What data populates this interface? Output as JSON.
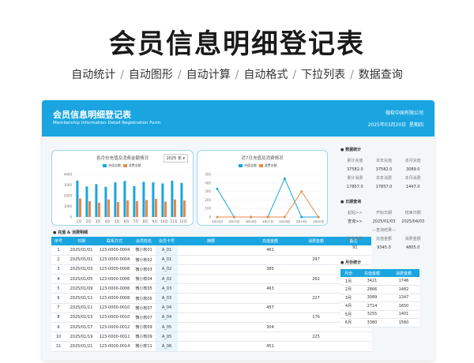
{
  "hero": {
    "title": "会员信息明细登记表",
    "features": [
      "自动统计",
      "自动图形",
      "自动计算",
      "自动格式",
      "下拉列表",
      "数据查询"
    ]
  },
  "banner": {
    "title": "会员信息明细登记表",
    "subtitle": "Membership Information Detail Registration Form",
    "company": "微软中国有限公司",
    "date": "2025年03月20日",
    "weekday": "星期四"
  },
  "colors": {
    "accent": "#1aa5e0",
    "orange": "#e88a4a"
  },
  "bar_chart": {
    "title": "各月份充值及消费金额情况",
    "year": "2025 年",
    "year_icon": "dropdown-icon",
    "legend": [
      "充值金额",
      "消费金额"
    ],
    "yticks": [
      "4000",
      "3000",
      "2000",
      "1000",
      "0"
    ]
  },
  "line_chart": {
    "title": "近7日充值及消费情况",
    "legend": [
      "充值金额",
      "消费金额"
    ],
    "yticks": [
      "500",
      "400",
      "300",
      "200",
      "100",
      "0"
    ]
  },
  "chart_data": [
    {
      "type": "bar",
      "title": "各月份充值及消费金额情况",
      "categories": [
        "1月",
        "2月",
        "3月",
        "4月",
        "5月",
        "6月",
        "7月",
        "8月",
        "9月",
        "10月",
        "11月",
        "12月"
      ],
      "series": [
        {
          "name": "充值金额",
          "values": [
            3421,
            2866,
            3089,
            2830,
            3255,
            3380,
            2900,
            3300,
            3250,
            3150,
            3400,
            3200
          ]
        },
        {
          "name": "消费金额",
          "values": [
            1746,
            1482,
            1347,
            1650,
            1401,
            1560,
            1500,
            1600,
            1700,
            1450,
            1650,
            1550
          ]
        }
      ],
      "ylim": [
        0,
        4000
      ]
    },
    {
      "type": "line",
      "title": "近7日充值及消费情况",
      "x": [
        "3月14日",
        "3月15日",
        "3月16日",
        "3月17日",
        "3月18日",
        "3月19日",
        "3月20日"
      ],
      "series": [
        {
          "name": "充值金额",
          "values": [
            330,
            0,
            0,
            0,
            450,
            0,
            0
          ]
        },
        {
          "name": "消费金额",
          "values": [
            0,
            0,
            0,
            0,
            0,
            300,
            0
          ]
        }
      ],
      "ylim": [
        0,
        500
      ]
    }
  ],
  "table": {
    "section_label": "充值 & 消费明细",
    "columns": [
      "序号",
      "日期",
      "联系方式",
      "会员姓名",
      "会员卡号",
      "摘要",
      "充值金额",
      "消费金额",
      "备注"
    ],
    "rows": [
      [
        "1",
        "2025/01/01",
        "123-0000-0004",
        "微小软01",
        "A_01",
        "",
        "461",
        "",
        ""
      ],
      [
        "2",
        "2025/01/01",
        "123-0000-0004",
        "微小软02",
        "A_01",
        "",
        "",
        "297",
        ""
      ],
      [
        "3",
        "2025/01/03",
        "123-0000-0006",
        "微小软03",
        "A_02",
        "",
        "385",
        "",
        ""
      ],
      [
        "4",
        "2025/01/05",
        "123-0000-0006",
        "微小软04",
        "A_02",
        "",
        "",
        "262",
        ""
      ],
      [
        "5",
        "2025/01/09",
        "123-0000-0006",
        "微小软05",
        "A_03",
        "",
        "463",
        "",
        ""
      ],
      [
        "6",
        "2025/01/11",
        "123-0000-0008",
        "微小软05",
        "A_03",
        "",
        "",
        "227",
        ""
      ],
      [
        "7",
        "2025/01/11",
        "123-0000-0010",
        "微小软07",
        "A_04",
        "",
        "457",
        "",
        ""
      ],
      [
        "8",
        "2025/01/15",
        "123-0000-0010",
        "微小软07",
        "A_04",
        "",
        "",
        "176",
        ""
      ],
      [
        "9",
        "2025/01/17",
        "123-0000-0012",
        "微小软09",
        "A_05",
        "",
        "304",
        "",
        ""
      ],
      [
        "10",
        "2025/01/19",
        "123-0000-0012",
        "微小软09",
        "A_05",
        "",
        "",
        "225",
        ""
      ],
      [
        "11",
        "2025/01/21",
        "123-0000-0014",
        "微小软11",
        "A_06",
        "",
        "451",
        "",
        ""
      ]
    ]
  },
  "side": {
    "data_stats": {
      "head": "数据统计",
      "rows": [
        [
          "累计充值",
          "本年充值",
          "本月充值"
        ],
        [
          "37582.0",
          "37582.0",
          "3089.0"
        ],
        [
          "累计消费",
          "本年消费",
          "本月消费"
        ],
        [
          "17857.0",
          "17857.0",
          "1447.0"
        ]
      ]
    },
    "date_query": {
      "head": "日期查询",
      "rows": [
        [
          "起始>>",
          "开始日期",
          "结束日期"
        ],
        [
          "查询>>",
          "2025/01/03",
          "2025/04/03"
        ],
        [
          "",
          "—查询结果—",
          ""
        ],
        [
          "查询次数",
          "充值金额",
          "消费金额"
        ],
        [
          "91",
          "9345.0",
          "4805.0"
        ]
      ]
    },
    "monthly": {
      "head": "月份统计",
      "columns": [
        "月份",
        "充值金额",
        "消费金额"
      ],
      "rows": [
        [
          "1月",
          "3421",
          "1746"
        ],
        [
          "2月",
          "2866",
          "1482"
        ],
        [
          "3月",
          "3089",
          "1347"
        ],
        [
          "4月",
          "2714",
          "1650"
        ],
        [
          "5月",
          "3255",
          "1401"
        ],
        [
          "6月",
          "3380",
          "1560"
        ]
      ]
    }
  }
}
